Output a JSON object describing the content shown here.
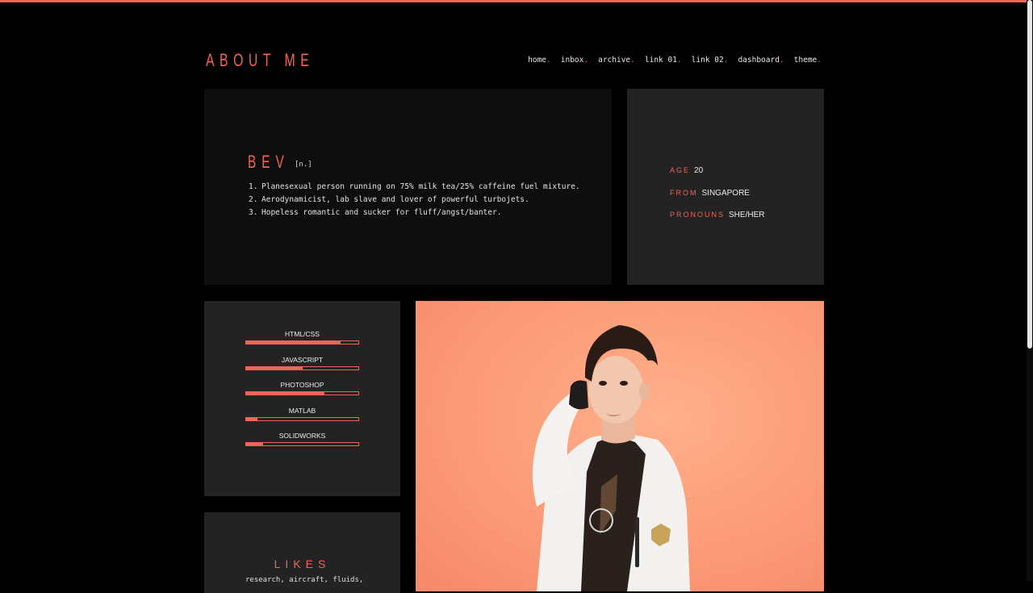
{
  "header": {
    "title": "ABOUT ME",
    "nav": [
      {
        "label": "home",
        "dot": "."
      },
      {
        "label": "inbox",
        "dot": "."
      },
      {
        "label": "archive",
        "dot": "."
      },
      {
        "label": "link 01",
        "dot": "."
      },
      {
        "label": "link 02",
        "dot": "."
      },
      {
        "label": "dashboard",
        "dot": "."
      },
      {
        "label": "theme",
        "dot": "."
      }
    ]
  },
  "bio": {
    "name": "BEV",
    "part_of_speech": "[n.]",
    "items": [
      {
        "num": "1.",
        "text": "Planesexual person running on 75% milk tea/25% caffeine fuel mixture."
      },
      {
        "num": "2.",
        "text": "Aerodynamicist, lab slave and lover of powerful turbojets."
      },
      {
        "num": "3.",
        "text": "Hopeless romantic and sucker for fluff/angst/banter."
      }
    ]
  },
  "info": {
    "age_key": "AGE",
    "age_val": "20",
    "from_key": "FROM",
    "from_val": "SINGAPORE",
    "pronouns_key": "PRONOUNS",
    "pronouns_val": "SHE/HER"
  },
  "skills": [
    {
      "label": "HTML/CSS",
      "level": 0.84
    },
    {
      "label": "JAVASCRIPT",
      "level": 0.5
    },
    {
      "label": "PHOTOSHOP",
      "level": 0.7
    },
    {
      "label": "MATLAB",
      "level": 0.1
    },
    {
      "label": "SOLIDWORKS",
      "level": 0.15
    }
  ],
  "likes": {
    "title": "LIKES",
    "items": "research, aircraft, fluids,"
  },
  "colors": {
    "accent": "#f0655a",
    "background": "#000000",
    "card_dark": "#0e0e0e",
    "card_grey": "#232323",
    "photo_bg": "#fd9e7a"
  },
  "photo": {
    "icon": "portrait-photo"
  }
}
